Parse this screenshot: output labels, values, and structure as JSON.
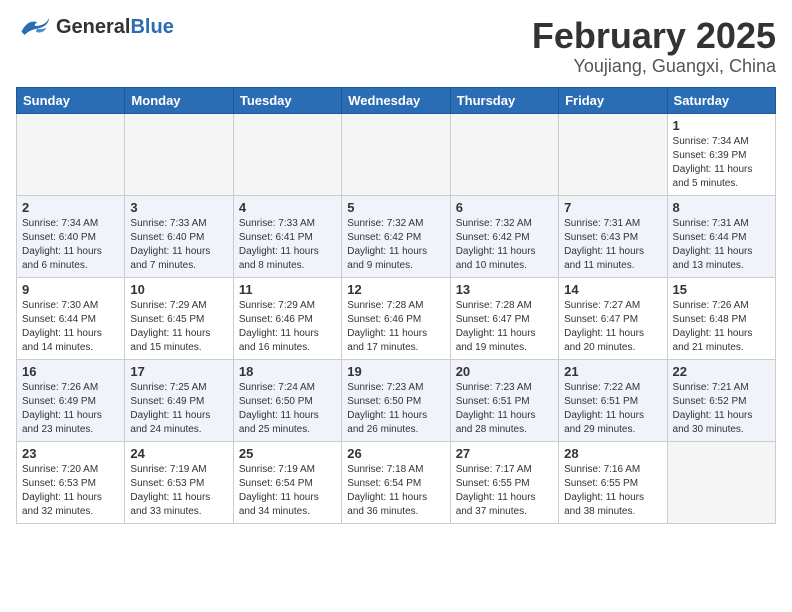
{
  "header": {
    "logo_general": "General",
    "logo_blue": "Blue",
    "title": "February 2025",
    "subtitle": "Youjiang, Guangxi, China"
  },
  "days_of_week": [
    "Sunday",
    "Monday",
    "Tuesday",
    "Wednesday",
    "Thursday",
    "Friday",
    "Saturday"
  ],
  "weeks": [
    [
      {
        "day": "",
        "info": ""
      },
      {
        "day": "",
        "info": ""
      },
      {
        "day": "",
        "info": ""
      },
      {
        "day": "",
        "info": ""
      },
      {
        "day": "",
        "info": ""
      },
      {
        "day": "",
        "info": ""
      },
      {
        "day": "1",
        "info": "Sunrise: 7:34 AM\nSunset: 6:39 PM\nDaylight: 11 hours\nand 5 minutes."
      }
    ],
    [
      {
        "day": "2",
        "info": "Sunrise: 7:34 AM\nSunset: 6:40 PM\nDaylight: 11 hours\nand 6 minutes."
      },
      {
        "day": "3",
        "info": "Sunrise: 7:33 AM\nSunset: 6:40 PM\nDaylight: 11 hours\nand 7 minutes."
      },
      {
        "day": "4",
        "info": "Sunrise: 7:33 AM\nSunset: 6:41 PM\nDaylight: 11 hours\nand 8 minutes."
      },
      {
        "day": "5",
        "info": "Sunrise: 7:32 AM\nSunset: 6:42 PM\nDaylight: 11 hours\nand 9 minutes."
      },
      {
        "day": "6",
        "info": "Sunrise: 7:32 AM\nSunset: 6:42 PM\nDaylight: 11 hours\nand 10 minutes."
      },
      {
        "day": "7",
        "info": "Sunrise: 7:31 AM\nSunset: 6:43 PM\nDaylight: 11 hours\nand 11 minutes."
      },
      {
        "day": "8",
        "info": "Sunrise: 7:31 AM\nSunset: 6:44 PM\nDaylight: 11 hours\nand 13 minutes."
      }
    ],
    [
      {
        "day": "9",
        "info": "Sunrise: 7:30 AM\nSunset: 6:44 PM\nDaylight: 11 hours\nand 14 minutes."
      },
      {
        "day": "10",
        "info": "Sunrise: 7:29 AM\nSunset: 6:45 PM\nDaylight: 11 hours\nand 15 minutes."
      },
      {
        "day": "11",
        "info": "Sunrise: 7:29 AM\nSunset: 6:46 PM\nDaylight: 11 hours\nand 16 minutes."
      },
      {
        "day": "12",
        "info": "Sunrise: 7:28 AM\nSunset: 6:46 PM\nDaylight: 11 hours\nand 17 minutes."
      },
      {
        "day": "13",
        "info": "Sunrise: 7:28 AM\nSunset: 6:47 PM\nDaylight: 11 hours\nand 19 minutes."
      },
      {
        "day": "14",
        "info": "Sunrise: 7:27 AM\nSunset: 6:47 PM\nDaylight: 11 hours\nand 20 minutes."
      },
      {
        "day": "15",
        "info": "Sunrise: 7:26 AM\nSunset: 6:48 PM\nDaylight: 11 hours\nand 21 minutes."
      }
    ],
    [
      {
        "day": "16",
        "info": "Sunrise: 7:26 AM\nSunset: 6:49 PM\nDaylight: 11 hours\nand 23 minutes."
      },
      {
        "day": "17",
        "info": "Sunrise: 7:25 AM\nSunset: 6:49 PM\nDaylight: 11 hours\nand 24 minutes."
      },
      {
        "day": "18",
        "info": "Sunrise: 7:24 AM\nSunset: 6:50 PM\nDaylight: 11 hours\nand 25 minutes."
      },
      {
        "day": "19",
        "info": "Sunrise: 7:23 AM\nSunset: 6:50 PM\nDaylight: 11 hours\nand 26 minutes."
      },
      {
        "day": "20",
        "info": "Sunrise: 7:23 AM\nSunset: 6:51 PM\nDaylight: 11 hours\nand 28 minutes."
      },
      {
        "day": "21",
        "info": "Sunrise: 7:22 AM\nSunset: 6:51 PM\nDaylight: 11 hours\nand 29 minutes."
      },
      {
        "day": "22",
        "info": "Sunrise: 7:21 AM\nSunset: 6:52 PM\nDaylight: 11 hours\nand 30 minutes."
      }
    ],
    [
      {
        "day": "23",
        "info": "Sunrise: 7:20 AM\nSunset: 6:53 PM\nDaylight: 11 hours\nand 32 minutes."
      },
      {
        "day": "24",
        "info": "Sunrise: 7:19 AM\nSunset: 6:53 PM\nDaylight: 11 hours\nand 33 minutes."
      },
      {
        "day": "25",
        "info": "Sunrise: 7:19 AM\nSunset: 6:54 PM\nDaylight: 11 hours\nand 34 minutes."
      },
      {
        "day": "26",
        "info": "Sunrise: 7:18 AM\nSunset: 6:54 PM\nDaylight: 11 hours\nand 36 minutes."
      },
      {
        "day": "27",
        "info": "Sunrise: 7:17 AM\nSunset: 6:55 PM\nDaylight: 11 hours\nand 37 minutes."
      },
      {
        "day": "28",
        "info": "Sunrise: 7:16 AM\nSunset: 6:55 PM\nDaylight: 11 hours\nand 38 minutes."
      },
      {
        "day": "",
        "info": ""
      }
    ]
  ]
}
